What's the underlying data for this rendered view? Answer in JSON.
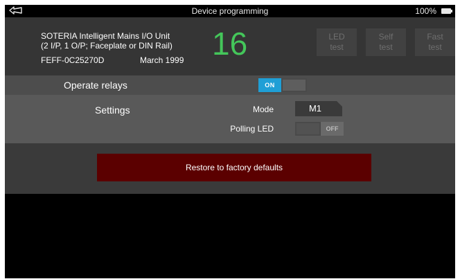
{
  "statusbar": {
    "title": "Device programming",
    "battery": "100%"
  },
  "device": {
    "name": "SOTERIA Intelligent Mains I/O Unit",
    "description": "(2 I/P, 1 O/P; Faceplate or DIN Rail)",
    "serial": "FEFF-0C25270D",
    "date": "March 1999",
    "address": "16",
    "address_color": "#44c65a"
  },
  "test_buttons": [
    {
      "line1": "LED",
      "line2": "test"
    },
    {
      "line1": "Self",
      "line2": "test"
    },
    {
      "line1": "Fast",
      "line2": "test"
    }
  ],
  "relays": {
    "label": "Operate relays",
    "state": "ON",
    "on_color": "#1f9fd6"
  },
  "settings": {
    "label": "Settings",
    "mode_label": "Mode",
    "mode_value": "M1",
    "polling_label": "Polling LED",
    "polling_state": "OFF"
  },
  "restore": {
    "label": "Restore to factory defaults",
    "color": "#5b0000"
  },
  "icons": {
    "back": "back-arrow-icon",
    "battery": "battery-icon"
  }
}
